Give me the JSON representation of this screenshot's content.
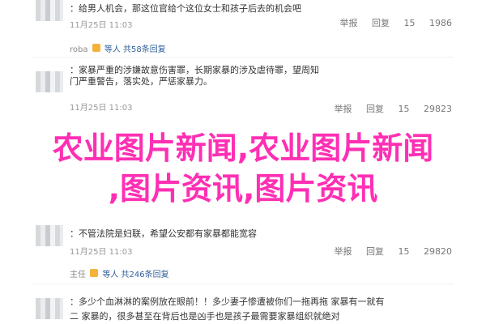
{
  "comments": [
    {
      "name": "",
      "text": "：给男人机会，那这位官给个这位女士和孩子后去的机会吧",
      "time": "11月25日 11:03",
      "actions": [
        "举报",
        "回复",
        "15",
        "1986"
      ]
    },
    {
      "name": "roba",
      "reply_text": "等人 共58条回复"
    },
    {
      "name": "",
      "text": "：家暴严重的涉嫌故意伤害罪，长期家暴的涉及虐待罪，望周知",
      "line2": "门严重警告，落实处，严惩家暴力。",
      "time": "11月25日 11:03",
      "actions": [
        "举报",
        "回复",
        "15",
        "29823"
      ]
    },
    {
      "name": "",
      "text": "：不管法院是妇联，希望公安都有家暴都能宽容",
      "time": "11月25日 11:03",
      "actions": [
        "举报",
        "回复",
        "15",
        "29820"
      ]
    },
    {
      "name": "主任",
      "reply_text": "等人 共246条回复"
    },
    {
      "name": "",
      "text": "：多少个血淋淋的案例放在眼前！！多少妻子惨遭被你们一拖再拖 家暴有一就有",
      "line2": "二 家暴的，很多甚至在背后也是凶手也是孩子最需要家暴组织就绝对",
      "time": "",
      "actions": []
    }
  ],
  "overlay": {
    "line1": "农业图片新闻,农业图片新闻",
    "line2": ",图片资讯,图片资讯"
  }
}
